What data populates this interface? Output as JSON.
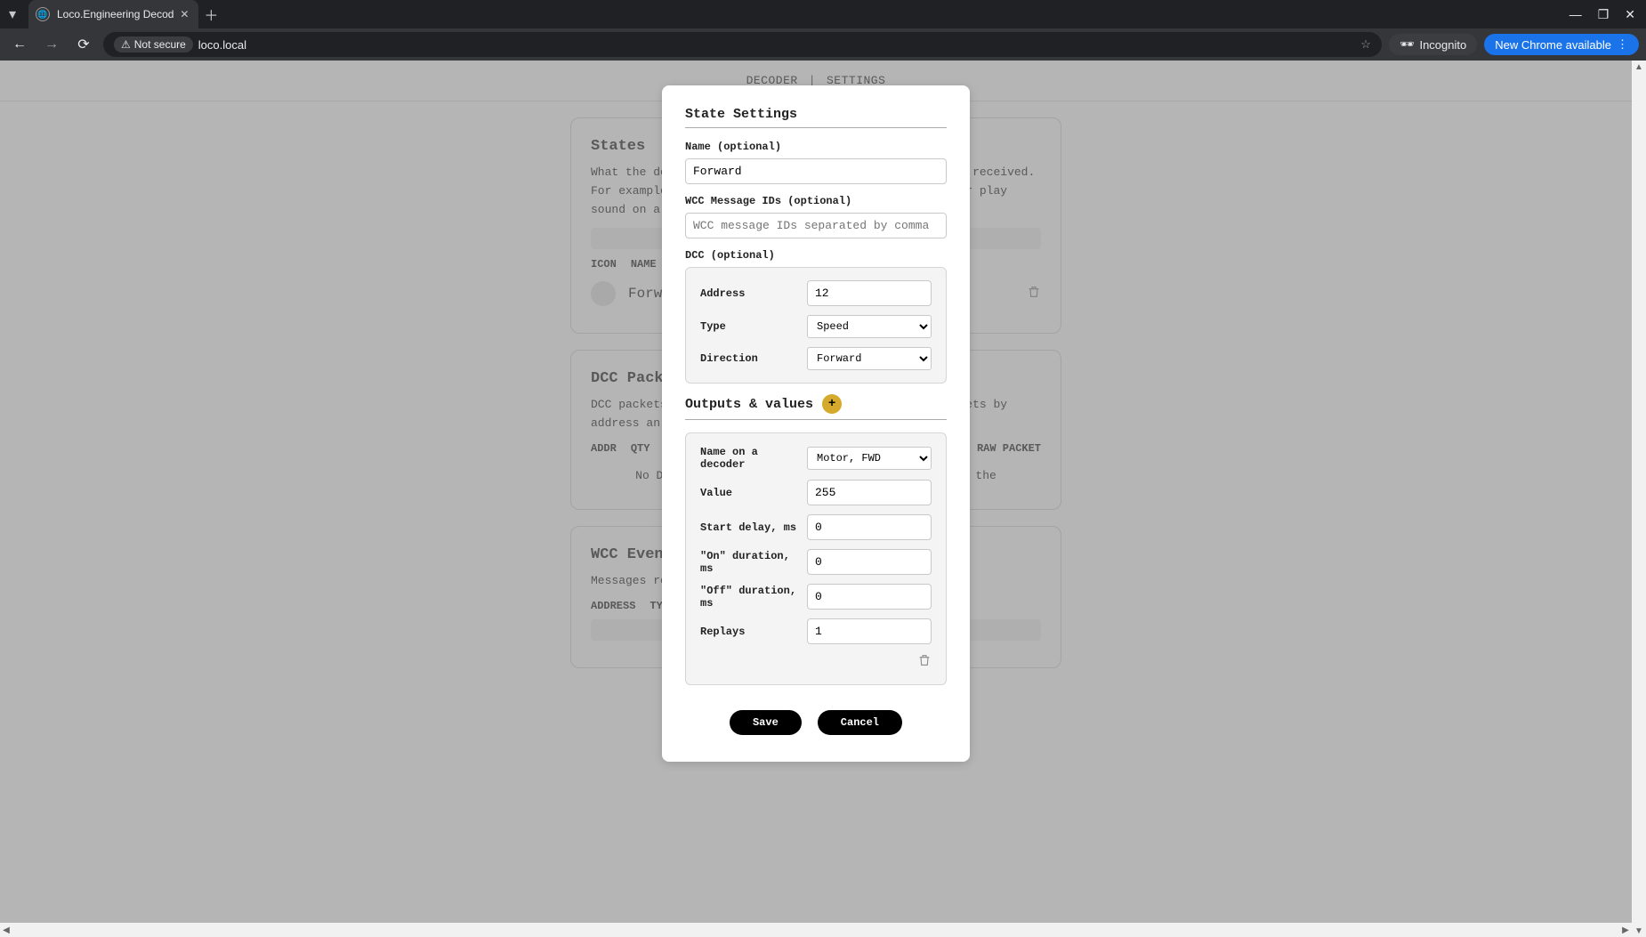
{
  "browser": {
    "tab_title": "Loco.Engineering Decod",
    "security_label": "Not secure",
    "url": "loco.local",
    "incognito_label": "Incognito",
    "update_label": "New Chrome available"
  },
  "nav": {
    "decoder": "DECODER",
    "settings": "SETTINGS",
    "divider": "|"
  },
  "states_card": {
    "title": "States",
    "desc": "What the decoder should do when one of the commands is received. For example, switch a LED on when DCC F1 is received or play sound on a s",
    "head_icon": "ICON",
    "head_name": "NAME",
    "row_name": "Forward"
  },
  "dcc_card": {
    "title": "DCC Packets",
    "desc": "DCC packets received during debug session. Filter packets by address an",
    "head_addr": "ADDR",
    "head_qty": "QTY",
    "head_raw": "RAW PACKET",
    "note": "No DCC packets received yet. Check DCC signal to the"
  },
  "wcc_card": {
    "title": "WCC Events",
    "desc": "Messages received from other decoders via WCC protocol",
    "head_addr": "ADDRESS",
    "head_type": "TYPE"
  },
  "modal": {
    "title": "State Settings",
    "name_label": "Name (optional)",
    "name_value": "Forward",
    "wcc_label": "WCC Message IDs (optional)",
    "wcc_placeholder": "WCC message IDs separated by comma",
    "dcc_label": "DCC (optional)",
    "dcc": {
      "address_label": "Address",
      "address_value": "12",
      "type_label": "Type",
      "type_value": "Speed",
      "direction_label": "Direction",
      "direction_value": "Forward"
    },
    "outputs_title": "Outputs & values",
    "out": {
      "name_label": "Name on a decoder",
      "name_value": "Motor, FWD",
      "value_label": "Value",
      "value_value": "255",
      "start_label": "Start delay, ms",
      "start_value": "0",
      "on_label": "\"On\" duration, ms",
      "on_value": "0",
      "off_label": "\"Off\" duration, ms",
      "off_value": "0",
      "replays_label": "Replays",
      "replays_value": "1"
    },
    "save": "Save",
    "cancel": "Cancel"
  }
}
